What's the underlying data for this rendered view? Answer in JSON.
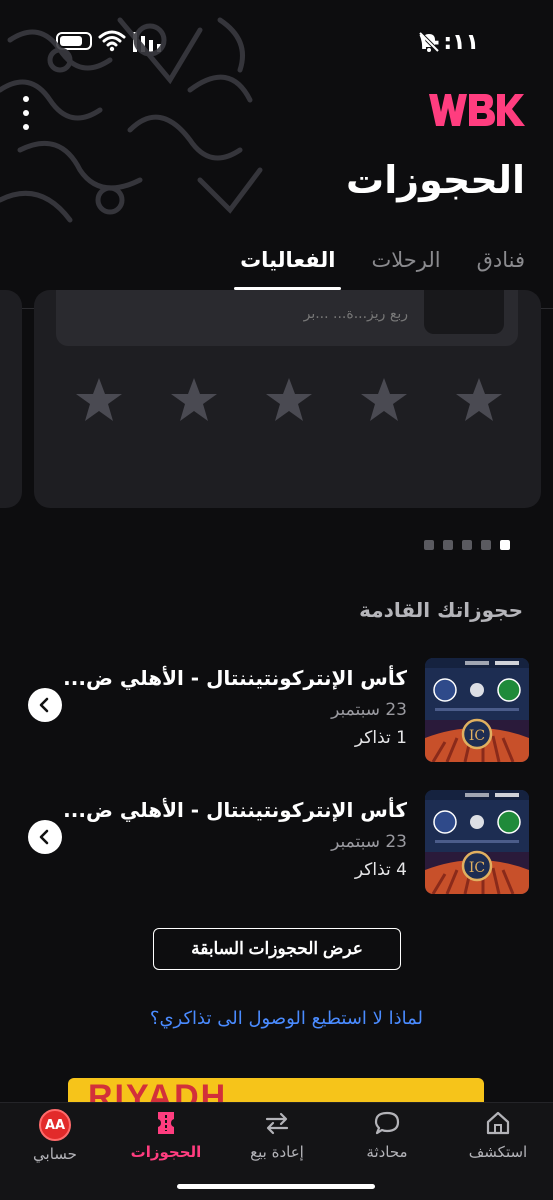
{
  "status_bar": {
    "time": "١٠:١١"
  },
  "header": {
    "logo": "WBK",
    "title": "الحجوزات",
    "tabs": [
      {
        "label": "الفعاليات",
        "active": true
      },
      {
        "label": "الرحلات",
        "active": false
      },
      {
        "label": "فنادق",
        "active": false
      }
    ]
  },
  "rating_card": {
    "faded_text": "ربع ريز...ة... ...بر"
  },
  "carousel": {
    "dots": 5,
    "active_dot": 1
  },
  "upcoming": {
    "title": "حجوزاتك القادمة",
    "items": [
      {
        "title": "كأس الإنتركونتيننتال - الأهلي ض...",
        "date": "23 سبتمبر",
        "tickets": "1 تذاكر"
      },
      {
        "title": "كأس الإنتركونتيننتال - الأهلي ض...",
        "date": "23 سبتمبر",
        "tickets": "4 تذاكر"
      }
    ]
  },
  "buttons": {
    "previous_bookings": "عرض الحجوزات السابقة"
  },
  "help_link": "لماذا لا استطيع الوصول الى تذاكري؟",
  "promo": {
    "text": "RIYADH"
  },
  "bottom_nav": [
    {
      "label": "استكشف",
      "icon": "home-icon"
    },
    {
      "label": "محادثة",
      "icon": "chat-icon"
    },
    {
      "label": "إعادة بيع",
      "icon": "resale-icon"
    },
    {
      "label": "الحجوزات",
      "icon": "ticket-icon",
      "active": true
    },
    {
      "label": "حسابي",
      "icon": "avatar",
      "avatar_initials": "AA"
    }
  ],
  "colors": {
    "accent": "#ff3d7f",
    "link": "#4a8bff",
    "background": "#0d0d0f"
  }
}
